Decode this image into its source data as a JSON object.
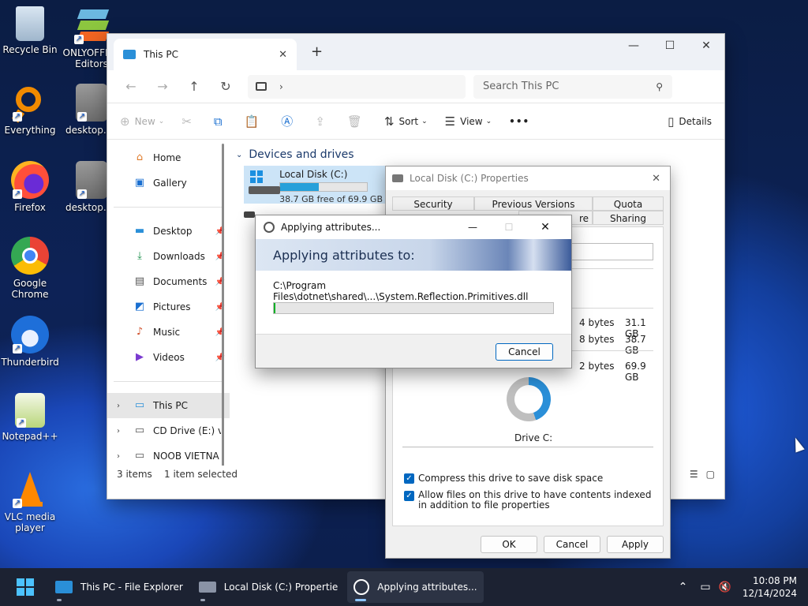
{
  "desktop": {
    "icons": [
      {
        "label": "Recycle Bin"
      },
      {
        "label": "ONLYOFFICE Editors"
      },
      {
        "label": "Everything"
      },
      {
        "label": "desktop.ini"
      },
      {
        "label": "Firefox"
      },
      {
        "label": "desktop.ini"
      },
      {
        "label": "Google Chrome"
      },
      {
        "label": "Thunderbird"
      },
      {
        "label": "Notepad++"
      },
      {
        "label": "VLC media player"
      }
    ]
  },
  "explorer": {
    "tab_title": "This PC",
    "search_placeholder": "Search This PC",
    "commands": {
      "new": "New",
      "sort": "Sort",
      "view": "View",
      "more": "•••",
      "details": "Details"
    },
    "sidebar": {
      "home": "Home",
      "gallery": "Gallery",
      "desktop": "Desktop",
      "downloads": "Downloads",
      "documents": "Documents",
      "pictures": "Pictures",
      "music": "Music",
      "videos": "Videos",
      "this_pc": "This PC",
      "cd_drive": "CD Drive (E:) virt",
      "noob": "NOOB VIETNA ("
    },
    "section_header": "Devices and drives",
    "drive": {
      "name": "Local Disk (C:)",
      "free_text": "38.7 GB free of 69.9 GB",
      "used_fraction": 0.446
    },
    "status": {
      "items": "3 items",
      "selected": "1 item selected"
    }
  },
  "properties": {
    "title": "Local Disk (C:) Properties",
    "tabs": {
      "security": "Security",
      "previous_versions": "Previous Versions",
      "quota": "Quota",
      "sharing": "Sharing",
      "partial": "re"
    },
    "used_bytes": "4 bytes",
    "used_gb": "31.1 GB",
    "free_bytes": "8 bytes",
    "free_gb": "38.7 GB",
    "cap_bytes": "2 bytes",
    "cap_gb": "69.9 GB",
    "drive_label": "Drive C:",
    "compress_label": "Compress this drive to save disk space",
    "index_label": "Allow files on this drive to have contents indexed in addition to file properties",
    "ok": "OK",
    "cancel": "Cancel",
    "apply": "Apply"
  },
  "applying": {
    "title": "Applying attributes...",
    "banner": "Applying attributes to:",
    "path": "C:\\Program Files\\dotnet\\shared\\...\\System.Reflection.Primitives.dll",
    "progress": 0.005,
    "cancel": "Cancel"
  },
  "taskbar": {
    "items": [
      {
        "label": "This PC - File Explorer"
      },
      {
        "label": "Local Disk (C:) Propertie"
      },
      {
        "label": "Applying attributes..."
      }
    ],
    "time": "10:08 PM",
    "date": "12/14/2024"
  }
}
